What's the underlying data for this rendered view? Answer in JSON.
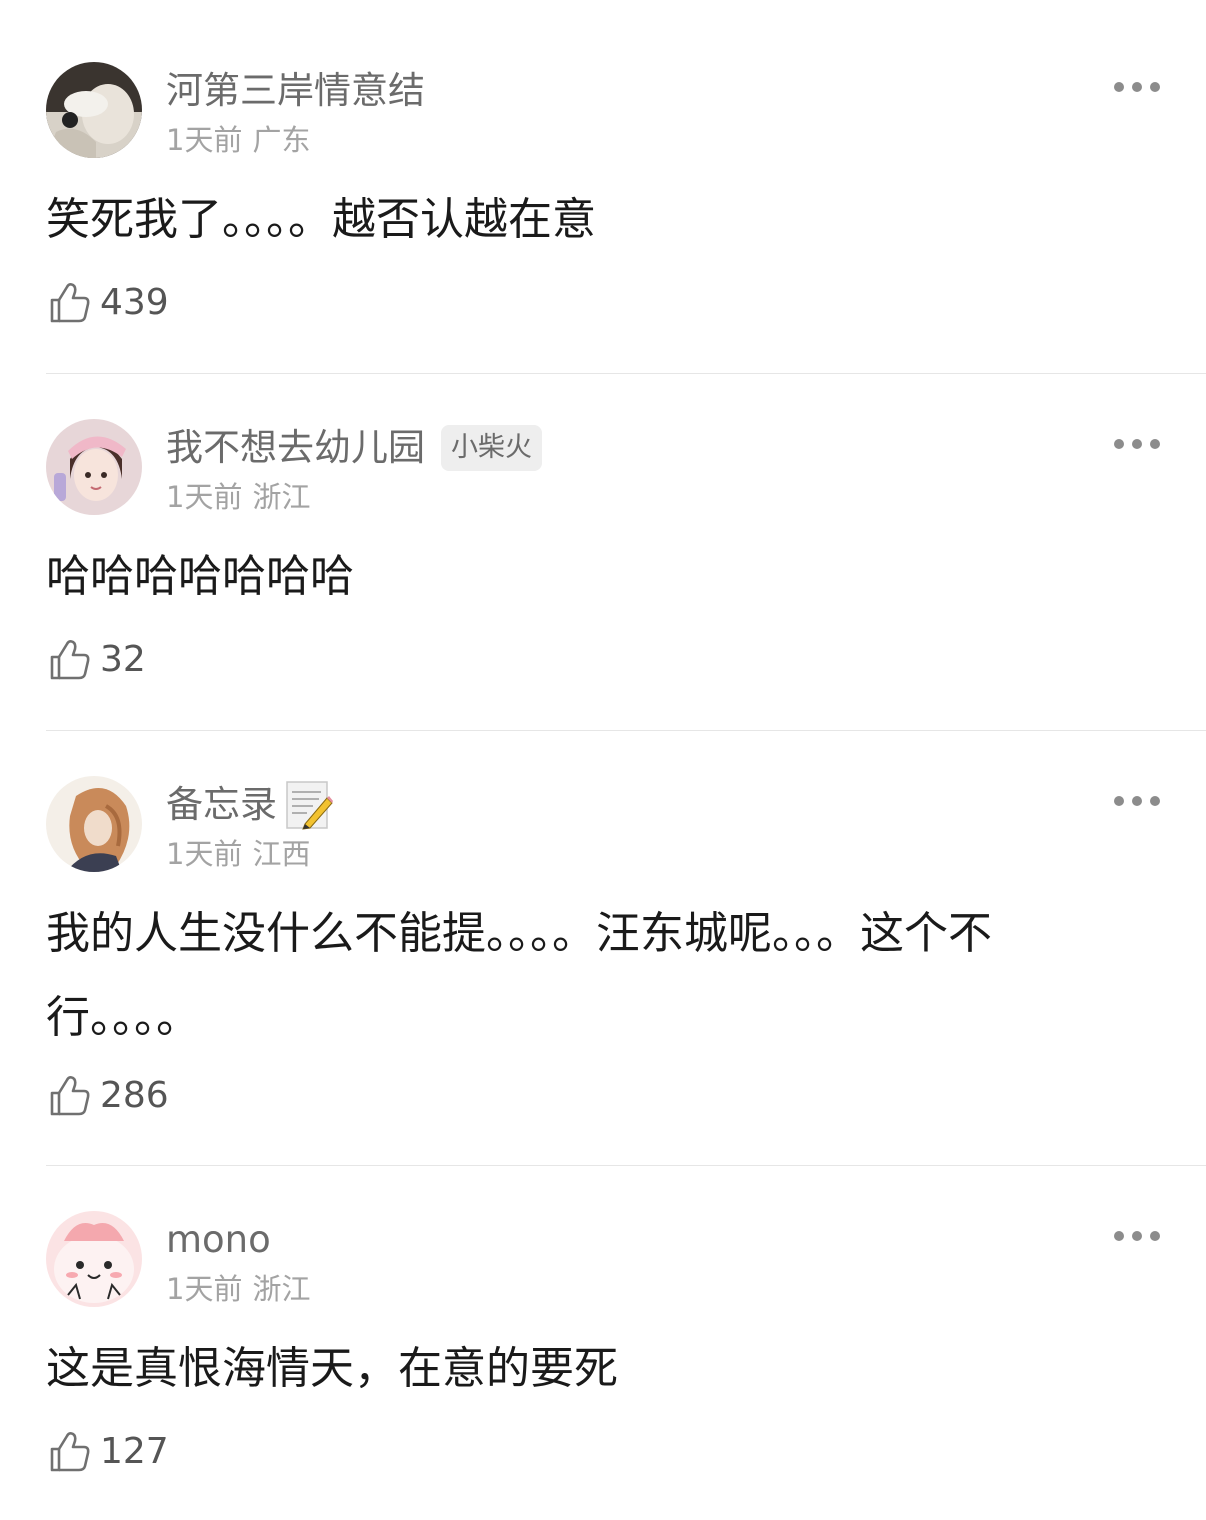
{
  "colors": {
    "username": "#6b6b6b",
    "meta": "#a3a3a3",
    "body": "#1a1a1a",
    "divider": "#e6e6e6",
    "icon": "#8c8c8c"
  },
  "comments": [
    {
      "username": "河第三岸情意结",
      "time": "1天前",
      "location": "广东",
      "text": "笑死我了。。。。越否认越在意",
      "likes": "439",
      "avatar_icon": "avatar-photo-icon"
    },
    {
      "username": "我不想去幼儿园",
      "badge": "小柴火",
      "time": "1天前",
      "location": "浙江",
      "text": "哈哈哈哈哈哈哈",
      "likes": "32",
      "avatar_icon": "avatar-girl-icon"
    },
    {
      "username": "备忘录",
      "name_emoji": "memo-emoji",
      "time": "1天前",
      "location": "江西",
      "text": "我的人生没什么不能提。。。。汪东城呢。。。这个不\n行。。。。",
      "likes": "286",
      "avatar_icon": "avatar-painting-icon"
    },
    {
      "username": "mono",
      "time": "1天前",
      "location": "浙江",
      "text": "这是真恨海情天，在意的要死",
      "likes": "127",
      "avatar_icon": "avatar-cartoon-icon"
    }
  ]
}
